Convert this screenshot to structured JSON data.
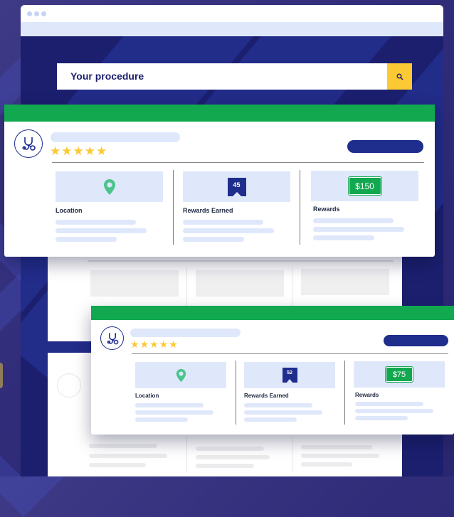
{
  "search": {
    "placeholder_text": "Your procedure",
    "icon": "search-icon"
  },
  "colors": {
    "navy": "#1b1f6e",
    "green": "#12a84f",
    "yellow": "#fbc934",
    "pale_blue": "#dfe8fb"
  },
  "listings": [
    {
      "rating": 5,
      "stars": "★★★★★",
      "avatar_icon": "stethoscope-icon",
      "location": {
        "icon": "map-pin-icon",
        "label": "Location"
      },
      "rewards_earned": {
        "value": "45",
        "label": "Rewards Earned"
      },
      "rewards": {
        "price": "$150",
        "label": "Rewards"
      }
    },
    {
      "rating": 5,
      "stars": "★★★★★",
      "avatar_icon": "stethoscope-icon",
      "location": {
        "icon": "map-pin-icon",
        "label": "Location"
      },
      "rewards_earned": {
        "value": "52",
        "label": "Rewards Earned"
      },
      "rewards": {
        "price": "$75",
        "label": "Rewards"
      }
    }
  ]
}
